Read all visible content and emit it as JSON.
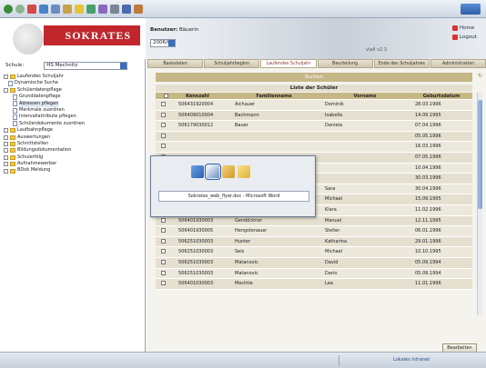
{
  "header": {
    "logo": "SOKRATES",
    "user_label": "Benutzer:",
    "user_name": "Bäuerin",
    "school_year": "2006/07",
    "version": "v\\all v2.3",
    "home_link": "Home",
    "logout_link": "Logout"
  },
  "sidebar": {
    "school_label": "Schule:",
    "school_value": "HS Mechnitz",
    "tree": [
      {
        "label": "Laufendes Schuljahr",
        "depth": 0,
        "icon": "folder"
      },
      {
        "label": "Dynamische Suche",
        "depth": 1,
        "icon": "page"
      },
      {
        "label": "Schülerdatenpflege",
        "depth": 0,
        "icon": "folder"
      },
      {
        "label": "Grunddatenpflege",
        "depth": 2,
        "icon": "page"
      },
      {
        "label": "Adressen pflegen",
        "depth": 2,
        "icon": "page",
        "selected": true
      },
      {
        "label": "Merkmale zuordnen",
        "depth": 2,
        "icon": "page"
      },
      {
        "label": "Intervallattribute pflegen",
        "depth": 2,
        "icon": "page"
      },
      {
        "label": "Schülerdokumente zuordnen",
        "depth": 2,
        "icon": "page"
      },
      {
        "label": "Laufbahnpflege",
        "depth": 0,
        "icon": "folder"
      },
      {
        "label": "Auswertungen",
        "depth": 0,
        "icon": "folder"
      },
      {
        "label": "Schnittstellen",
        "depth": 0,
        "icon": "folder"
      },
      {
        "label": "Bildungsdokumentation",
        "depth": 0,
        "icon": "folder"
      },
      {
        "label": "Schulerfolg",
        "depth": 0,
        "icon": "folder"
      },
      {
        "label": "Aufnahmewerber",
        "depth": 0,
        "icon": "folder"
      },
      {
        "label": "BDok Meldung",
        "depth": 0,
        "icon": "folder"
      }
    ]
  },
  "tabs": [
    {
      "label": "Basisdaten",
      "active": false
    },
    {
      "label": "Schuljahrbeginn",
      "active": false
    },
    {
      "label": "Laufendes Schuljahr",
      "active": true
    },
    {
      "label": "Beurteilung",
      "active": false
    },
    {
      "label": "Ende des Schuljahres",
      "active": false
    },
    {
      "label": "Administration",
      "active": false
    }
  ],
  "main": {
    "title": "Suchen",
    "list_title": "Liste der Schüler",
    "columns": [
      "",
      "Kennzahl",
      "Familienname",
      "Vorname",
      "Geburtsdatum"
    ],
    "rows": [
      [
        "506431920004",
        "Aichauer",
        "Dominik",
        "28.03.1996"
      ],
      [
        "506409010004",
        "Bachmann",
        "Isabella",
        "14.09.1995"
      ],
      [
        "506179030012",
        "Bauer",
        "Daniela",
        "07.04.1996"
      ],
      [
        "",
        "",
        "",
        "05.05.1996"
      ],
      [
        "",
        "",
        "",
        "16.03.1996"
      ],
      [
        "",
        "",
        "",
        "07.05.1996"
      ],
      [
        "",
        "",
        "",
        "10.04.1996"
      ],
      [
        "",
        "",
        "",
        "30.03.1996"
      ],
      [
        "506173030007",
        "Edler",
        "Sara",
        "30.04.1996"
      ],
      [
        "506401810007",
        "Einbacher",
        "Michael",
        "15.09.1995"
      ],
      [
        "506171030003",
        "Fieldbauer",
        "Klara",
        "11.02.1996"
      ],
      [
        "506401930003",
        "Gendöckner",
        "Manuel",
        "12.11.1995"
      ],
      [
        "506401930005",
        "Hengstenauer",
        "Stefan",
        "06.01.1996"
      ],
      [
        "506251030003",
        "Hunter",
        "Katharina",
        "29.01.1996"
      ],
      [
        "506251030003",
        "Seis",
        "Michael",
        "10.10.1995"
      ],
      [
        "506251030003",
        "Matanovic",
        "David",
        "05.09.1994"
      ],
      [
        "506251030003",
        "Matanovic",
        "Dario",
        "05.09.1994"
      ],
      [
        "506401030003",
        "Mechtle",
        "Lea",
        "11.01.1996"
      ]
    ],
    "edit_button": "Bearbeiten"
  },
  "switcher": {
    "label": "Sokrates_web_flyer.doc - Microsoft Word"
  },
  "status": {
    "trusted": "Lokales Intranet"
  },
  "colors": {
    "logo_red": "#c0262c",
    "accent_tan": "#c6b787",
    "row_odd": "#e4dfcf",
    "row_even": "#ece8dc"
  }
}
